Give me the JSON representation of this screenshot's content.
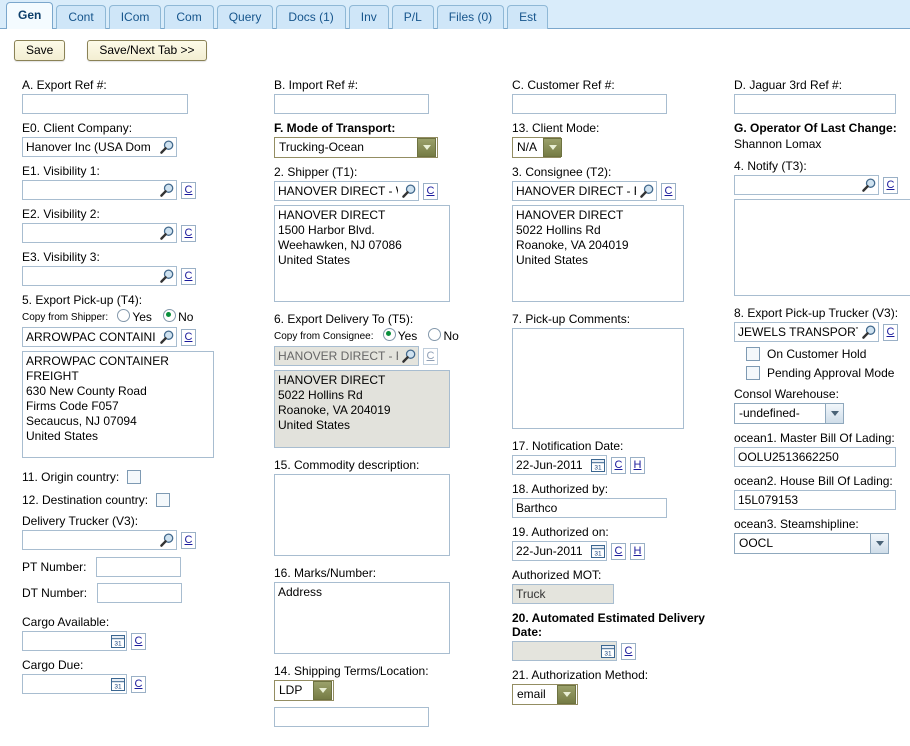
{
  "tabs": [
    {
      "label": "Gen",
      "active": true
    },
    {
      "label": "Cont",
      "active": false
    },
    {
      "label": "ICom",
      "active": false
    },
    {
      "label": "Com",
      "active": false
    },
    {
      "label": "Query",
      "active": false
    },
    {
      "label": "Docs (1)",
      "active": false
    },
    {
      "label": "Inv",
      "active": false
    },
    {
      "label": "P/L",
      "active": false
    },
    {
      "label": "Files (0)",
      "active": false
    },
    {
      "label": "Est",
      "active": false
    }
  ],
  "toolbar": {
    "save_label": "Save",
    "save_next_label": "Save/Next Tab >>"
  },
  "col1": {
    "export_ref_label": "A. Export Ref #:",
    "export_ref_value": "",
    "client_company_label": "E0. Client Company:",
    "client_company_value": "Hanover Inc (USA Dom",
    "visibility1_label": "E1. Visibility 1:",
    "visibility1_value": "",
    "visibility2_label": "E2. Visibility 2:",
    "visibility2_value": "",
    "visibility3_label": "E3. Visibility 3:",
    "visibility3_value": "",
    "export_pickup_label": "5. Export Pick-up (T4):",
    "copy_from_shipper_label": "Copy from Shipper:",
    "radio_yes": "Yes",
    "radio_no": "No",
    "copy_from_shipper_selected": "No",
    "pickup_lookup_value": "ARROWPAC CONTAINI",
    "pickup_address": "ARROWPAC CONTAINER\nFREIGHT\n630 New County Road\nFirms Code F057\nSecaucus, NJ 07094\nUnited States",
    "origin_country_label": "11. Origin country:",
    "origin_country_checked": false,
    "destination_country_label": "12. Destination country:",
    "destination_country_checked": false,
    "delivery_trucker_label": "Delivery Trucker (V3):",
    "delivery_trucker_value": "",
    "pt_number_label": "PT Number:",
    "pt_number_value": "",
    "dt_number_label": "DT Number:",
    "dt_number_value": "",
    "cargo_available_label": "Cargo Available:",
    "cargo_available_value": "",
    "cargo_due_label": "Cargo Due:",
    "cargo_due_value": "",
    "c_button": "C"
  },
  "col2": {
    "import_ref_label": "B. Import Ref #:",
    "import_ref_value": "",
    "mode_of_transport_label": "F. Mode of Transport:",
    "mode_of_transport_value": "Trucking-Ocean",
    "shipper_label": "2. Shipper (T1):",
    "shipper_lookup_value": "HANOVER DIRECT - W",
    "shipper_address": "HANOVER DIRECT\n1500 Harbor Blvd.\nWeehawken, NJ 07086\nUnited States",
    "export_delivery_label": "6. Export Delivery To (T5):",
    "copy_from_consignee_label": "Copy from Consignee:",
    "radio_yes": "Yes",
    "radio_no": "No",
    "copy_from_consignee_selected": "Yes",
    "delivery_lookup_value": "HANOVER DIRECT - R",
    "delivery_address": "HANOVER DIRECT\n5022 Hollins Rd\nRoanoke, VA 204019\nUnited States",
    "commodity_label": "15. Commodity description:",
    "commodity_value": "",
    "marks_label": "16. Marks/Number:",
    "marks_value": "Address",
    "shipping_terms_label": "14. Shipping Terms/Location:",
    "shipping_terms_value": "LDP",
    "shipping_location_value": "",
    "c_button": "C"
  },
  "col3": {
    "customer_ref_label": "C. Customer Ref #:",
    "customer_ref_value": "",
    "client_mode_label": "13. Client Mode:",
    "client_mode_value": "N/A",
    "consignee_label": "3. Consignee (T2):",
    "consignee_lookup_value": "HANOVER DIRECT - R",
    "consignee_address": "HANOVER DIRECT\n5022 Hollins Rd\nRoanoke, VA 204019\nUnited States",
    "pickup_comments_label": "7. Pick-up Comments:",
    "pickup_comments_value": "",
    "notification_date_label": "17. Notification Date:",
    "notification_date_value": "22-Jun-2011",
    "authorized_by_label": "18. Authorized by:",
    "authorized_by_value": "Barthco",
    "authorized_on_label": "19. Authorized on:",
    "authorized_on_value": "22-Jun-2011",
    "authorized_mot_label": "Authorized MOT:",
    "authorized_mot_value": "Truck",
    "aedd_label": "20. Automated Estimated Delivery Date:",
    "aedd_value": "",
    "auth_method_label": "21. Authorization Method:",
    "auth_method_value": "email",
    "c_button": "C",
    "h_button": "H"
  },
  "col4": {
    "jaguar_ref_label": "D. Jaguar 3rd Ref #:",
    "jaguar_ref_value": "",
    "operator_label": "G. Operator Of Last Change:",
    "operator_value": "Shannon Lomax",
    "notify_label": "4. Notify (T3):",
    "notify_lookup_value": "",
    "notify_address": "",
    "export_pickup_trucker_label": "8. Export Pick-up Trucker (V3):",
    "export_pickup_trucker_value": "JEWELS TRANSPORTA",
    "on_customer_hold_label": "On Customer Hold",
    "on_customer_hold_checked": false,
    "pending_approval_label": "Pending Approval Mode",
    "pending_approval_checked": false,
    "consol_warehouse_label": "Consol Warehouse:",
    "consol_warehouse_value": "-undefined-",
    "mbl_label": "ocean1. Master Bill Of Lading:",
    "mbl_value": "OOLU2513662250",
    "hbl_label": "ocean2. House Bill Of Lading:",
    "hbl_value": "15L079153",
    "steamshipline_label": "ocean3. Steamshipline:",
    "steamshipline_value": "OOCL",
    "c_button": "C"
  },
  "colors": {
    "tab_active_bg": "#f4fbff",
    "tab_inactive_bg": "#cfe6f8",
    "tabbar_bg": "#d9ecfa",
    "button_bg": "#f3eed2",
    "readonly_bg": "#e2e2dc",
    "radio_dot": "#0a8f3c",
    "link_blue": "#1a1a9c"
  }
}
